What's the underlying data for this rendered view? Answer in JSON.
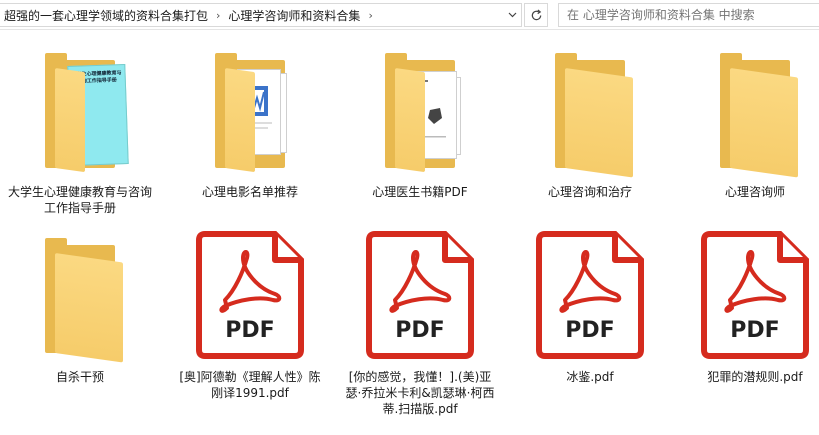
{
  "address_bar": {
    "crumbs": [
      "超强的一套心理学领域的资料合集打包",
      "心理学咨询师和资料合集"
    ]
  },
  "search": {
    "placeholder": "在 心理学咨询师和资料合集 中搜索"
  },
  "items": [
    {
      "label": "大学生心理健康教育与咨询工作指导手册",
      "kind": "folder",
      "cover_title": "大学生心理健康教育与咨询工作指导手册"
    },
    {
      "label": "心理电影名单推荐",
      "kind": "folder"
    },
    {
      "label": "心理医生书籍PDF",
      "kind": "folder"
    },
    {
      "label": "心理咨询和治疗",
      "kind": "folder"
    },
    {
      "label": "心理咨询师",
      "kind": "folder"
    },
    {
      "label": "自杀干预",
      "kind": "folder"
    },
    {
      "label": "[奥]阿德勒《理解人性》陈刚译1991.pdf",
      "kind": "pdf"
    },
    {
      "label": "[你的感觉，我懂！].(美)亚瑟·乔拉米卡利&凯瑟琳·柯西蒂.扫描版.pdf",
      "kind": "pdf"
    },
    {
      "label": "冰鉴.pdf",
      "kind": "pdf"
    },
    {
      "label": "犯罪的潜规则.pdf",
      "kind": "pdf"
    }
  ],
  "pdf_badge": "PDF",
  "colors": {
    "pdf_red": "#d52b1e",
    "folder": "#f6cc6a",
    "folder_back": "#e8b94f"
  },
  "icons": [
    "chevron-right-icon",
    "chevron-down-icon",
    "refresh-icon",
    "folder-icon",
    "pdf-icon"
  ]
}
